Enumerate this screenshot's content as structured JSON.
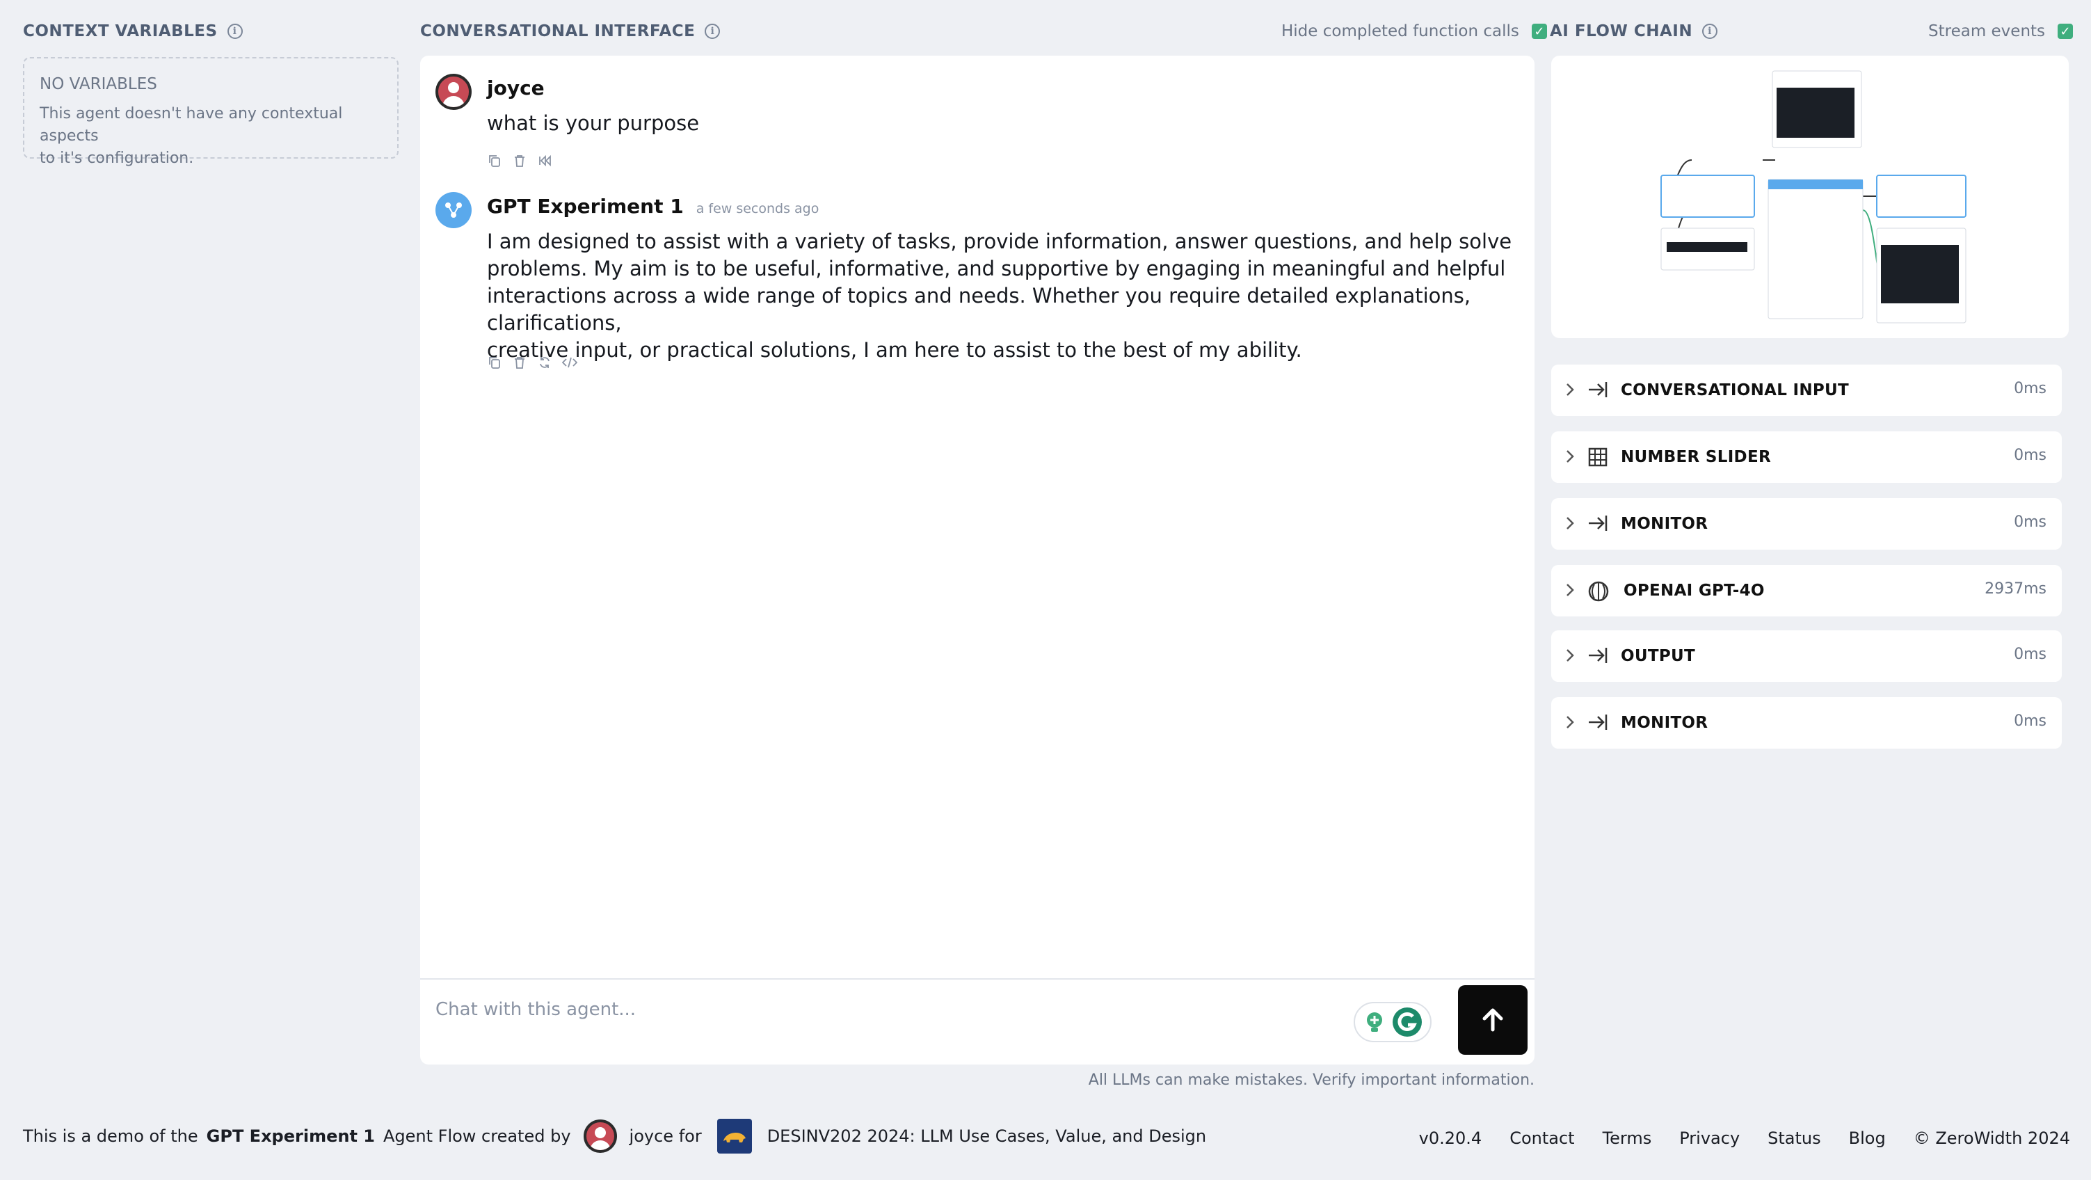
{
  "context": {
    "title": "CONTEXT VARIABLES",
    "empty_title": "NO VARIABLES",
    "empty_desc_1": "This agent doesn't have any contextual aspects",
    "empty_desc_2": "to it's configuration."
  },
  "chat": {
    "title": "CONVERSATIONAL INTERFACE",
    "hide_completed_label": "Hide completed function calls",
    "messages": [
      {
        "author": "joyce",
        "time": "",
        "text": "what is your purpose"
      },
      {
        "author": "GPT Experiment 1",
        "time": "a few seconds ago",
        "lines": [
          "I am designed to assist with a variety of tasks, provide information, answer questions, and help solve",
          "problems. My aim is to be useful, informative, and supportive by engaging in meaningful and helpful",
          "interactions across a wide range of topics and needs. Whether you require detailed explanations, clarifications,",
          "creative input, or practical solutions, I am here to assist to the best of my ability."
        ]
      }
    ],
    "input_placeholder": "Chat with this agent...",
    "disclaimer": "All LLMs can make mistakes. Verify important information."
  },
  "flow": {
    "title": "AI FLOW CHAIN",
    "stream_label": "Stream events",
    "items": [
      {
        "label": "CONVERSATIONAL INPUT",
        "ms": "0ms",
        "icon": "arrow-to-line-icon"
      },
      {
        "label": "NUMBER SLIDER",
        "ms": "0ms",
        "icon": "grid-icon"
      },
      {
        "label": "MONITOR",
        "ms": "0ms",
        "icon": "arrow-to-line-icon"
      },
      {
        "label": "OPENAI GPT-4O",
        "ms": "2937ms",
        "icon": "openai-icon"
      },
      {
        "label": "OUTPUT",
        "ms": "0ms",
        "icon": "arrow-to-line-icon"
      },
      {
        "label": "MONITOR",
        "ms": "0ms",
        "icon": "arrow-to-line-icon"
      }
    ]
  },
  "footer": {
    "prefix": "This is a demo of the",
    "agent_name": "GPT Experiment 1",
    "middle": "Agent Flow created by",
    "creator": "joyce for",
    "org": "DESINV202 2024: LLM Use Cases, Value, and Design",
    "version": "v0.20.4",
    "links": [
      "Contact",
      "Terms",
      "Privacy",
      "Status",
      "Blog"
    ],
    "copyright": "© ZeroWidth 2024"
  },
  "colors": {
    "accent_green": "#3fae7e",
    "bot_blue": "#5aa9ec",
    "user_red": "#c74a55"
  }
}
